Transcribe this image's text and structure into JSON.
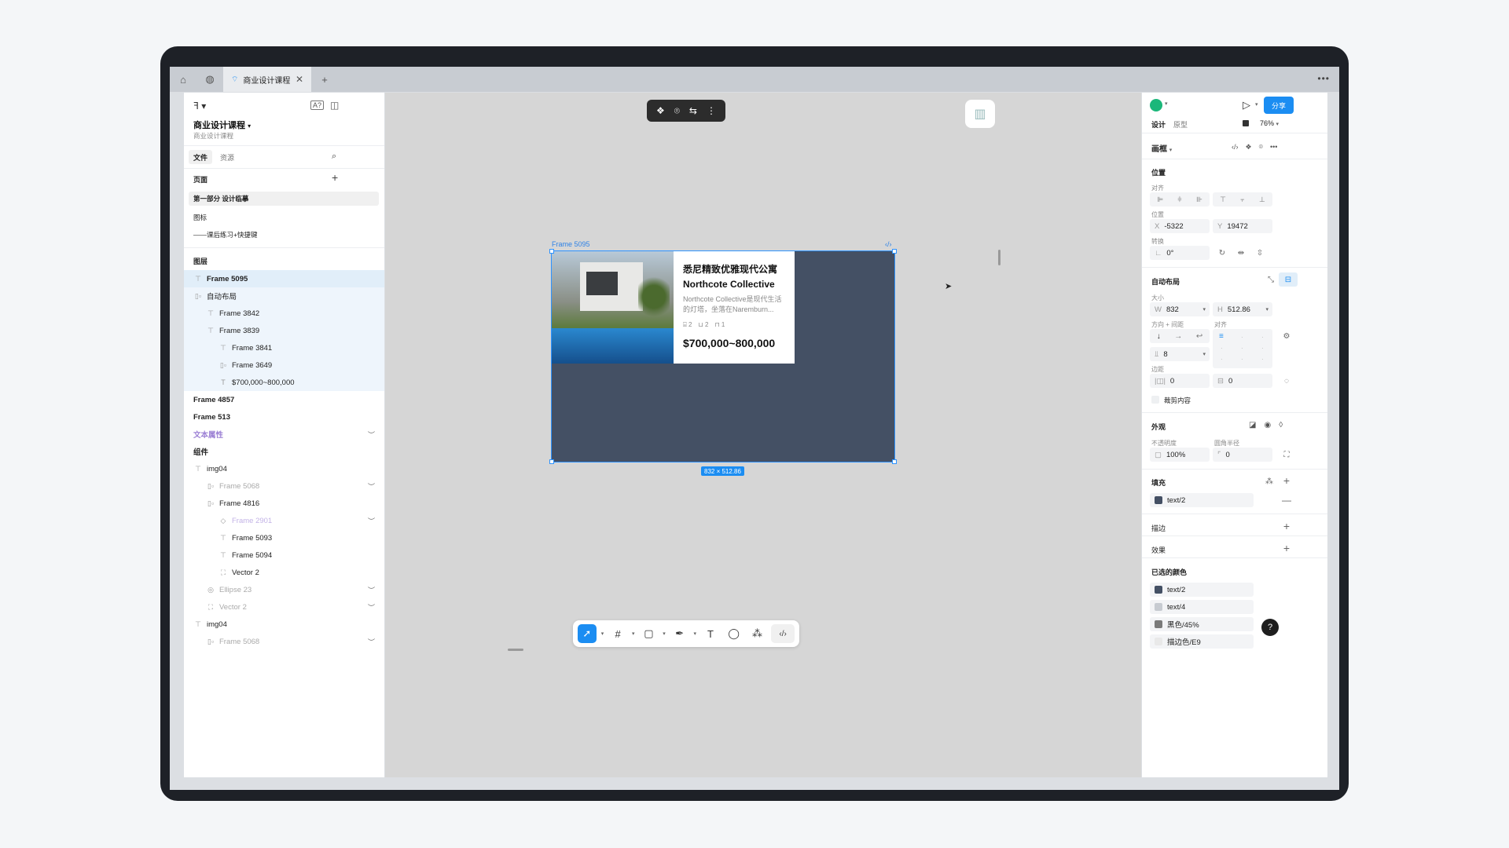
{
  "tabbar": {
    "tab_title": "商业设计课程"
  },
  "left": {
    "file_name": "商业设计课程",
    "file_sub": "商业设计课程",
    "tabs": [
      "文件",
      "资源"
    ],
    "pages_label": "页面",
    "pages": [
      "第一部分 设计临摹",
      "图标",
      "——课后练习+快捷键"
    ],
    "layers_label": "图层",
    "layers": [
      {
        "label": "Frame 5095",
        "depth": 0,
        "state": "sel",
        "icon": "frame-icon"
      },
      {
        "label": "自动布局",
        "depth": 0,
        "state": "grp",
        "icon": "auto-layout-icon"
      },
      {
        "label": "Frame 3842",
        "depth": 1,
        "state": "grp",
        "icon": "frame-icon"
      },
      {
        "label": "Frame 3839",
        "depth": 1,
        "state": "grp",
        "icon": "frame-icon"
      },
      {
        "label": "Frame 3841",
        "depth": 2,
        "state": "grp",
        "icon": "frame-icon"
      },
      {
        "label": "Frame 3649",
        "depth": 2,
        "state": "grp",
        "icon": "auto-layout-icon"
      },
      {
        "label": "$700,000~800,000",
        "depth": 2,
        "state": "grp",
        "icon": "text-icon"
      },
      {
        "label": "Frame 4857",
        "depth": -1,
        "state": "",
        "icon": ""
      },
      {
        "label": "Frame 513",
        "depth": -1,
        "state": "",
        "icon": ""
      },
      {
        "label": "文本属性",
        "depth": -1,
        "state": "purple",
        "icon": ""
      },
      {
        "label": "组件",
        "depth": -1,
        "state": "",
        "icon": ""
      },
      {
        "label": "img04",
        "depth": 0,
        "state": "",
        "icon": "frame-icon"
      },
      {
        "label": "Frame 5068",
        "depth": 1,
        "state": "dim",
        "icon": "auto-layout-icon"
      },
      {
        "label": "Frame 4816",
        "depth": 1,
        "state": "",
        "icon": "auto-layout-icon"
      },
      {
        "label": "Frame 2901",
        "depth": 2,
        "state": "dimpurple",
        "icon": "component-icon"
      },
      {
        "label": "Frame 5093",
        "depth": 2,
        "state": "",
        "icon": "frame-icon"
      },
      {
        "label": "Frame 5094",
        "depth": 2,
        "state": "",
        "icon": "frame-icon"
      },
      {
        "label": "Vector 2",
        "depth": 2,
        "state": "",
        "icon": "vector-icon"
      },
      {
        "label": "Ellipse 23",
        "depth": 1,
        "state": "dim",
        "icon": "ellipse-icon"
      },
      {
        "label": "Vector 2",
        "depth": 1,
        "state": "dim",
        "icon": "vector-icon"
      },
      {
        "label": "img04",
        "depth": 0,
        "state": "",
        "icon": "frame-icon"
      },
      {
        "label": "Frame 5068",
        "depth": 1,
        "state": "dim",
        "icon": "auto-layout-icon"
      }
    ]
  },
  "canvas": {
    "frame_label": "Frame 5095",
    "frame_size": "832 × 512.86",
    "card": {
      "title_cn": "悉尼精致优雅现代公寓",
      "title_en": "Northcote Collective",
      "desc": "Northcote Collective是现代生活的灯塔，坐落在Naremburn...",
      "beds": "2",
      "baths": "2",
      "cars": "1",
      "price": "$700,000~800,000"
    }
  },
  "right": {
    "share_label": "分享",
    "tabs": [
      "设计",
      "原型"
    ],
    "zoom": "76%",
    "frame_type": "画框",
    "position_label": "位置",
    "align_label": "对齐",
    "pos_label": "位置",
    "x": "-5322",
    "y": "19472",
    "transform_label": "转换",
    "rotation": "0°",
    "auto_layout_label": "自动布局",
    "size_label": "大小",
    "w": "832",
    "h": "512.86",
    "direction_label": "方向 + 间距",
    "align2_label": "对齐",
    "gap": "8",
    "padding_label": "边距",
    "pad_h": "0",
    "pad_v": "0",
    "clip_label": "裁剪内容",
    "appearance_label": "外观",
    "opacity_label": "不透明度",
    "radius_label": "圆角半径",
    "opacity": "100%",
    "radius": "0",
    "fill_label": "填充",
    "fill_value": "text/2",
    "stroke_label": "描边",
    "effect_label": "效果",
    "selected_colors_label": "已选的颜色",
    "selected_colors": [
      {
        "name": "text/2",
        "color": "#445064"
      },
      {
        "name": "text/4",
        "color": "#c7cbd1"
      },
      {
        "name": "黑色/45%",
        "color": "#7a7a7a"
      },
      {
        "name": "描边色/E9",
        "color": "#e9e9e9"
      }
    ],
    "help": "?"
  },
  "colors": {
    "accent": "#1b8df2",
    "frame_fill": "#445064"
  }
}
